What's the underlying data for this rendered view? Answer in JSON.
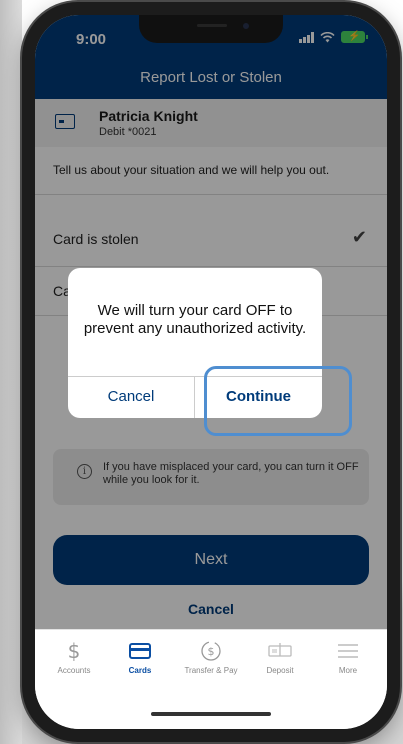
{
  "status": {
    "time": "9:00"
  },
  "header": {
    "title": "Report Lost or Stolen"
  },
  "account": {
    "name": "Patricia Knight",
    "number": "Debit *0021",
    "icon": "card-icon"
  },
  "intro": "Tell us about your situation and we will help you out.",
  "options": [
    {
      "label": "Card is stolen",
      "selected": true
    },
    {
      "label": "Card is lost",
      "selected": false
    }
  ],
  "info": {
    "icon": "info-icon",
    "text": "If you have misplaced your card, you can turn it OFF while you look for it."
  },
  "actions": {
    "next_label": "Next",
    "cancel_label": "Cancel"
  },
  "dialog": {
    "message": "We will turn your card OFF to prevent any unauthorized activity.",
    "cancel_label": "Cancel",
    "continue_label": "Continue"
  },
  "tabs": [
    {
      "label": "Accounts",
      "icon": "dollar-icon",
      "active": false
    },
    {
      "label": "Cards",
      "icon": "card-icon",
      "active": true
    },
    {
      "label": "Transfer & Pay",
      "icon": "transfer-icon",
      "active": false
    },
    {
      "label": "Deposit",
      "icon": "deposit-icon",
      "active": false
    },
    {
      "label": "More",
      "icon": "menu-icon",
      "active": false
    }
  ],
  "colors": {
    "brand": "#003b7a",
    "highlight": "#4f8ed0",
    "battery": "#4cd964"
  }
}
